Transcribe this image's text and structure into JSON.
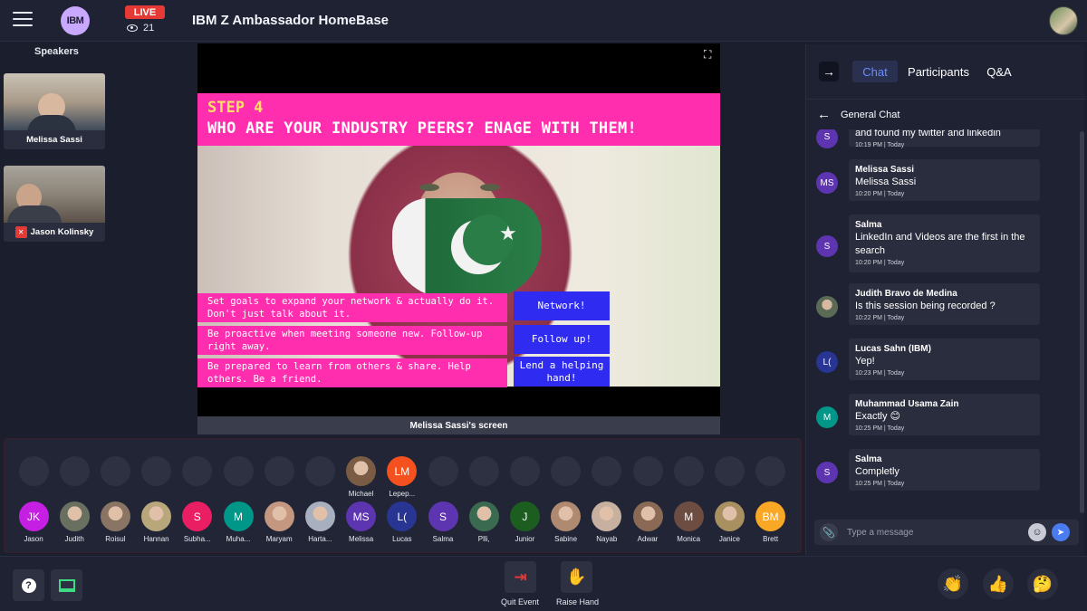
{
  "header": {
    "logo_text": "IBM",
    "live_label": "LIVE",
    "viewer_count": "21",
    "event_title": "IBM Z Ambassador HomeBase"
  },
  "speakers": {
    "label": "Speakers",
    "items": [
      {
        "name": "Melissa Sassi",
        "muted": false
      },
      {
        "name": "Jason Kolinsky",
        "muted": true
      }
    ]
  },
  "stage": {
    "slide": {
      "step": "STEP 4",
      "title": "WHO ARE YOUR INDUSTRY PEERS? ENAGE WITH THEM!",
      "tips": [
        {
          "text": "Set goals to expand your network & actually do it. Don't just talk about it.",
          "button": "Network!"
        },
        {
          "text": "Be proactive when meeting someone new. Follow-up right away.",
          "button": "Follow up!"
        },
        {
          "text": "Be prepared to learn from others & share. Help others. Be a friend.",
          "button": "Lend a helping hand!"
        }
      ]
    },
    "screen_label": "Melissa Sassi's screen"
  },
  "audience": {
    "top_row": [
      {
        "name": "Michael",
        "initials": "",
        "photo": true,
        "color": "#7a5c44"
      },
      {
        "name": "Lepep...",
        "initials": "LM",
        "photo": false,
        "color": "#f4511e"
      }
    ],
    "bottom_row": [
      {
        "name": "Jason",
        "initials": "JK",
        "photo": false,
        "color": "#c51fe3"
      },
      {
        "name": "Judith",
        "initials": "",
        "photo": true,
        "color": "#6a7060"
      },
      {
        "name": "Roisul",
        "initials": "",
        "photo": true,
        "color": "#8a7565"
      },
      {
        "name": "Hannan",
        "initials": "",
        "photo": true,
        "color": "#b8a77a"
      },
      {
        "name": "Subha...",
        "initials": "S",
        "photo": false,
        "color": "#e91e63"
      },
      {
        "name": "Muha...",
        "initials": "M",
        "photo": false,
        "color": "#009688"
      },
      {
        "name": "Maryam",
        "initials": "",
        "photo": true,
        "color": "#c49880"
      },
      {
        "name": "Harta...",
        "initials": "",
        "photo": true,
        "color": "#a8b0c0"
      },
      {
        "name": "Melissa",
        "initials": "MS",
        "photo": false,
        "color": "#5e35b1"
      },
      {
        "name": "Lucas",
        "initials": "L(",
        "photo": false,
        "color": "#283593"
      },
      {
        "name": "Salma",
        "initials": "S",
        "photo": false,
        "color": "#5e35b1"
      },
      {
        "name": "Plli,",
        "initials": "",
        "photo": true,
        "color": "#3a6a50"
      },
      {
        "name": "Junior",
        "initials": "J",
        "photo": false,
        "color": "#1b5e20"
      },
      {
        "name": "Sabine",
        "initials": "",
        "photo": true,
        "color": "#b08a70"
      },
      {
        "name": "Nayab",
        "initials": "",
        "photo": true,
        "color": "#c8b0a0"
      },
      {
        "name": "Adwar",
        "initials": "",
        "photo": true,
        "color": "#8a6a55"
      },
      {
        "name": "Monica",
        "initials": "M",
        "photo": false,
        "color": "#6d4c41"
      },
      {
        "name": "Janice",
        "initials": "",
        "photo": true,
        "color": "#a89060"
      },
      {
        "name": "Brett",
        "initials": "BM",
        "photo": false,
        "color": "#f9a825"
      }
    ]
  },
  "bottombar": {
    "quit_label": "Quit Event",
    "raise_label": "Raise Hand"
  },
  "chat": {
    "tabs": [
      "Chat",
      "Participants",
      "Q&A"
    ],
    "active_tab": "Chat",
    "room": "General Chat",
    "messages": [
      {
        "initials": "S",
        "color": "#5e35b1",
        "name": "",
        "text": "and found my twitter and linkedin",
        "time": "10:19 PM | Today"
      },
      {
        "initials": "MS",
        "color": "#5e35b1",
        "name": "Melissa Sassi",
        "text": "Melissa Sassi",
        "time": "10:20 PM | Today"
      },
      {
        "initials": "S",
        "color": "#5e35b1",
        "name": "Salma",
        "text": "LinkedIn and Videos are the first in the search",
        "time": "10:20 PM | Today"
      },
      {
        "initials": "",
        "color": "#5a6a55",
        "name": "Judith Bravo de Medina",
        "text": "Is this session being recorded ?",
        "time": "10:22 PM | Today"
      },
      {
        "initials": "L(",
        "color": "#283593",
        "name": "Lucas Sahn (IBM)",
        "text": "Yep!",
        "time": "10:23 PM | Today"
      },
      {
        "initials": "M",
        "color": "#009688",
        "name": "Muhammad Usama Zain",
        "text": "Exactly 😊",
        "time": "10:25 PM | Today"
      },
      {
        "initials": "S",
        "color": "#5e35b1",
        "name": "Salma",
        "text": "Completly",
        "time": "10:25 PM | Today"
      }
    ],
    "composer_placeholder": "Type a message"
  }
}
